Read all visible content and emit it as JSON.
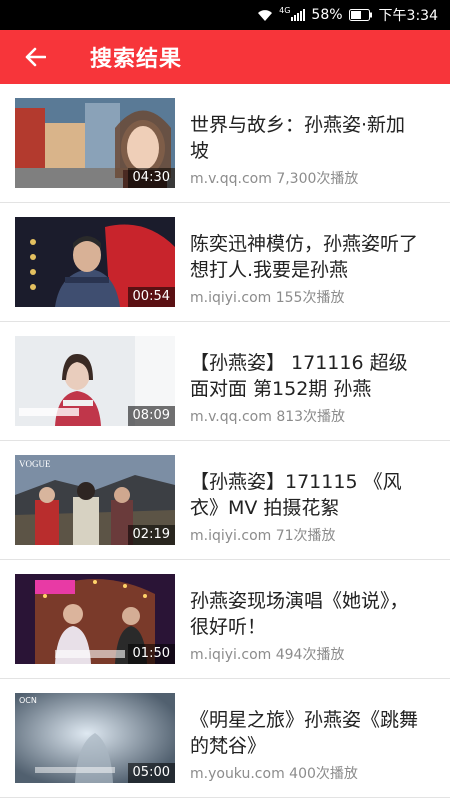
{
  "status_bar": {
    "network": "4G",
    "battery": "58%",
    "time": "下午3:34"
  },
  "app_bar": {
    "back_icon": "arrow-left-icon",
    "title": "搜索结果"
  },
  "results": [
    {
      "title": "世界与故乡：孙燕姿·新加坡",
      "duration": "04:30",
      "source": "m.v.qq.com",
      "plays": "7,300次播放"
    },
    {
      "title": "陈奕迅神模仿，孙燕姿听了想打人.我要是孙燕",
      "duration": "00:54",
      "source": "m.iqiyi.com",
      "plays": "155次播放"
    },
    {
      "title": "【孙燕姿】 171116 超级面对面 第152期 孙燕",
      "duration": "08:09",
      "source": "m.v.qq.com",
      "plays": "813次播放"
    },
    {
      "title": "【孙燕姿】171115 《风衣》MV 拍摄花絮",
      "duration": "02:19",
      "source": "m.iqiyi.com",
      "plays": "71次播放"
    },
    {
      "title": "孙燕姿现场演唱《她说》，很好听！",
      "duration": "01:50",
      "source": "m.iqiyi.com",
      "plays": "494次播放"
    },
    {
      "title": "《明星之旅》孙燕姿《跳舞的梵谷》",
      "duration": "05:00",
      "source": "m.youku.com",
      "plays": "400次播放"
    }
  ],
  "colors": {
    "app_bar": "#f7353a",
    "title_text": "#222222",
    "meta_text": "#8c8c8c"
  }
}
